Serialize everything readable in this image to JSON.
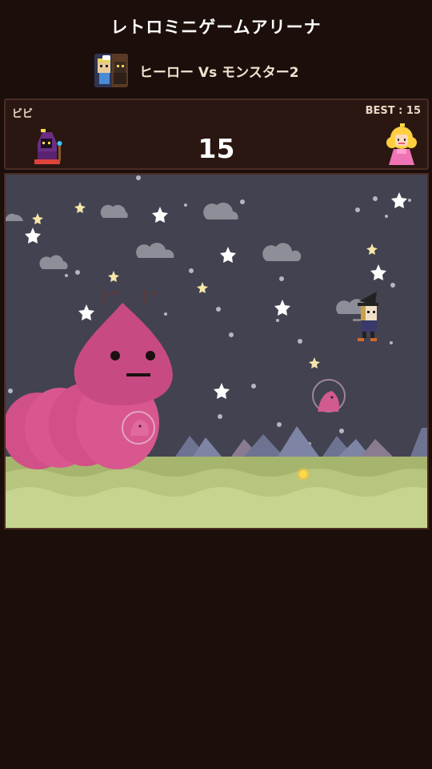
{
  "header": {
    "title": "レトロミニゲームアリーナ"
  },
  "game": {
    "name": "ヒーロー Vs モンスター2",
    "thumbnail_icon": "hero-vs-monster-thumbnail"
  },
  "scoreboard": {
    "player_name": "ビビ",
    "best_label": "BEST : 15",
    "score": "15",
    "player_avatar_icon": "purple-hooded-mage-icon",
    "rival_avatar_icon": "blonde-princess-icon"
  },
  "scene": {
    "sky_color": "#424251",
    "ground_color": "#a6b56e",
    "monster_color": "#d8578e",
    "hero_icon": "witch-hat-hero-icon",
    "monster_icon": "pink-worm-monster-icon",
    "bubble_icon": "pink-minion-bubble-icon",
    "coin_icon": "gold-coin-icon"
  }
}
